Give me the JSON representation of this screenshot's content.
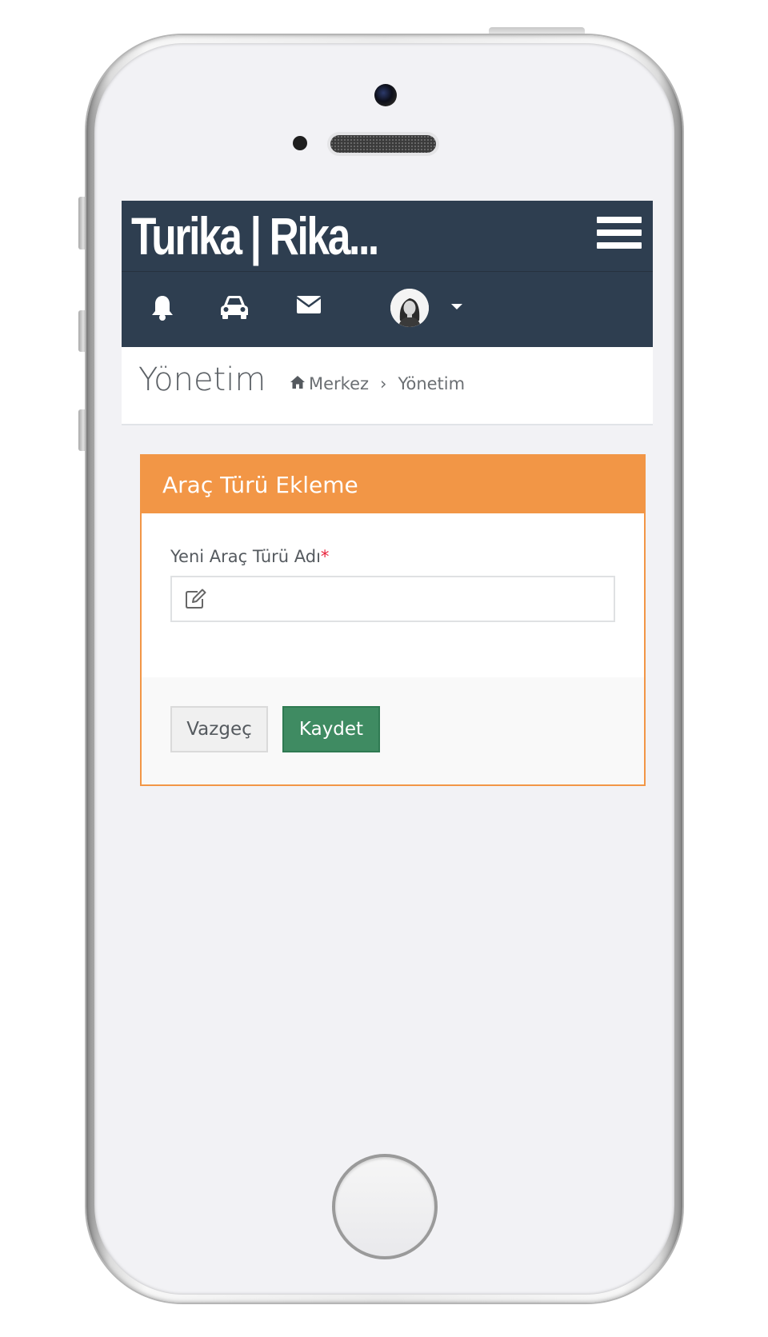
{
  "app": {
    "logo_text": "Turika | Rika..."
  },
  "topbar": {
    "menu_icon": "hamburger-menu-icon"
  },
  "iconbar": {
    "items": [
      {
        "icon": "bell-icon"
      },
      {
        "icon": "car-icon"
      },
      {
        "icon": "envelope-icon"
      },
      {
        "icon": "user-avatar"
      }
    ],
    "dropdown_icon": "caret-down-icon"
  },
  "page_header": {
    "title": "Yönetim",
    "breadcrumb": {
      "home": "Merkez",
      "current": "Yönetim"
    }
  },
  "form": {
    "title": "Araç Türü Ekleme",
    "field_label": "Yeni Araç Türü Adı",
    "required_mark": "*",
    "input_value": "",
    "input_icon": "edit-icon",
    "cancel_label": "Vazgeç",
    "save_label": "Kaydet"
  },
  "colors": {
    "navbar": "#2e3e50",
    "panel_accent": "#f29646",
    "save_button": "#3f8b62",
    "required": "#e8233c"
  }
}
